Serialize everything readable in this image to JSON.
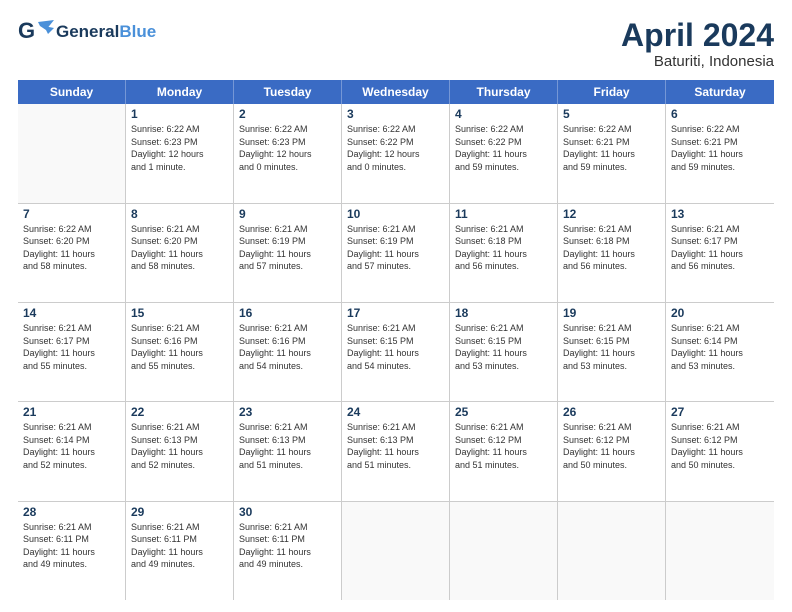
{
  "header": {
    "logo_general": "General",
    "logo_blue": "Blue",
    "month_title": "April 2024",
    "location": "Baturiti, Indonesia"
  },
  "days_of_week": [
    "Sunday",
    "Monday",
    "Tuesday",
    "Wednesday",
    "Thursday",
    "Friday",
    "Saturday"
  ],
  "weeks": [
    [
      {
        "day": "",
        "info": ""
      },
      {
        "day": "1",
        "info": "Sunrise: 6:22 AM\nSunset: 6:23 PM\nDaylight: 12 hours\nand 1 minute."
      },
      {
        "day": "2",
        "info": "Sunrise: 6:22 AM\nSunset: 6:23 PM\nDaylight: 12 hours\nand 0 minutes."
      },
      {
        "day": "3",
        "info": "Sunrise: 6:22 AM\nSunset: 6:22 PM\nDaylight: 12 hours\nand 0 minutes."
      },
      {
        "day": "4",
        "info": "Sunrise: 6:22 AM\nSunset: 6:22 PM\nDaylight: 11 hours\nand 59 minutes."
      },
      {
        "day": "5",
        "info": "Sunrise: 6:22 AM\nSunset: 6:21 PM\nDaylight: 11 hours\nand 59 minutes."
      },
      {
        "day": "6",
        "info": "Sunrise: 6:22 AM\nSunset: 6:21 PM\nDaylight: 11 hours\nand 59 minutes."
      }
    ],
    [
      {
        "day": "7",
        "info": "Sunrise: 6:22 AM\nSunset: 6:20 PM\nDaylight: 11 hours\nand 58 minutes."
      },
      {
        "day": "8",
        "info": "Sunrise: 6:21 AM\nSunset: 6:20 PM\nDaylight: 11 hours\nand 58 minutes."
      },
      {
        "day": "9",
        "info": "Sunrise: 6:21 AM\nSunset: 6:19 PM\nDaylight: 11 hours\nand 57 minutes."
      },
      {
        "day": "10",
        "info": "Sunrise: 6:21 AM\nSunset: 6:19 PM\nDaylight: 11 hours\nand 57 minutes."
      },
      {
        "day": "11",
        "info": "Sunrise: 6:21 AM\nSunset: 6:18 PM\nDaylight: 11 hours\nand 56 minutes."
      },
      {
        "day": "12",
        "info": "Sunrise: 6:21 AM\nSunset: 6:18 PM\nDaylight: 11 hours\nand 56 minutes."
      },
      {
        "day": "13",
        "info": "Sunrise: 6:21 AM\nSunset: 6:17 PM\nDaylight: 11 hours\nand 56 minutes."
      }
    ],
    [
      {
        "day": "14",
        "info": "Sunrise: 6:21 AM\nSunset: 6:17 PM\nDaylight: 11 hours\nand 55 minutes."
      },
      {
        "day": "15",
        "info": "Sunrise: 6:21 AM\nSunset: 6:16 PM\nDaylight: 11 hours\nand 55 minutes."
      },
      {
        "day": "16",
        "info": "Sunrise: 6:21 AM\nSunset: 6:16 PM\nDaylight: 11 hours\nand 54 minutes."
      },
      {
        "day": "17",
        "info": "Sunrise: 6:21 AM\nSunset: 6:15 PM\nDaylight: 11 hours\nand 54 minutes."
      },
      {
        "day": "18",
        "info": "Sunrise: 6:21 AM\nSunset: 6:15 PM\nDaylight: 11 hours\nand 53 minutes."
      },
      {
        "day": "19",
        "info": "Sunrise: 6:21 AM\nSunset: 6:15 PM\nDaylight: 11 hours\nand 53 minutes."
      },
      {
        "day": "20",
        "info": "Sunrise: 6:21 AM\nSunset: 6:14 PM\nDaylight: 11 hours\nand 53 minutes."
      }
    ],
    [
      {
        "day": "21",
        "info": "Sunrise: 6:21 AM\nSunset: 6:14 PM\nDaylight: 11 hours\nand 52 minutes."
      },
      {
        "day": "22",
        "info": "Sunrise: 6:21 AM\nSunset: 6:13 PM\nDaylight: 11 hours\nand 52 minutes."
      },
      {
        "day": "23",
        "info": "Sunrise: 6:21 AM\nSunset: 6:13 PM\nDaylight: 11 hours\nand 51 minutes."
      },
      {
        "day": "24",
        "info": "Sunrise: 6:21 AM\nSunset: 6:13 PM\nDaylight: 11 hours\nand 51 minutes."
      },
      {
        "day": "25",
        "info": "Sunrise: 6:21 AM\nSunset: 6:12 PM\nDaylight: 11 hours\nand 51 minutes."
      },
      {
        "day": "26",
        "info": "Sunrise: 6:21 AM\nSunset: 6:12 PM\nDaylight: 11 hours\nand 50 minutes."
      },
      {
        "day": "27",
        "info": "Sunrise: 6:21 AM\nSunset: 6:12 PM\nDaylight: 11 hours\nand 50 minutes."
      }
    ],
    [
      {
        "day": "28",
        "info": "Sunrise: 6:21 AM\nSunset: 6:11 PM\nDaylight: 11 hours\nand 49 minutes."
      },
      {
        "day": "29",
        "info": "Sunrise: 6:21 AM\nSunset: 6:11 PM\nDaylight: 11 hours\nand 49 minutes."
      },
      {
        "day": "30",
        "info": "Sunrise: 6:21 AM\nSunset: 6:11 PM\nDaylight: 11 hours\nand 49 minutes."
      },
      {
        "day": "",
        "info": ""
      },
      {
        "day": "",
        "info": ""
      },
      {
        "day": "",
        "info": ""
      },
      {
        "day": "",
        "info": ""
      }
    ]
  ]
}
